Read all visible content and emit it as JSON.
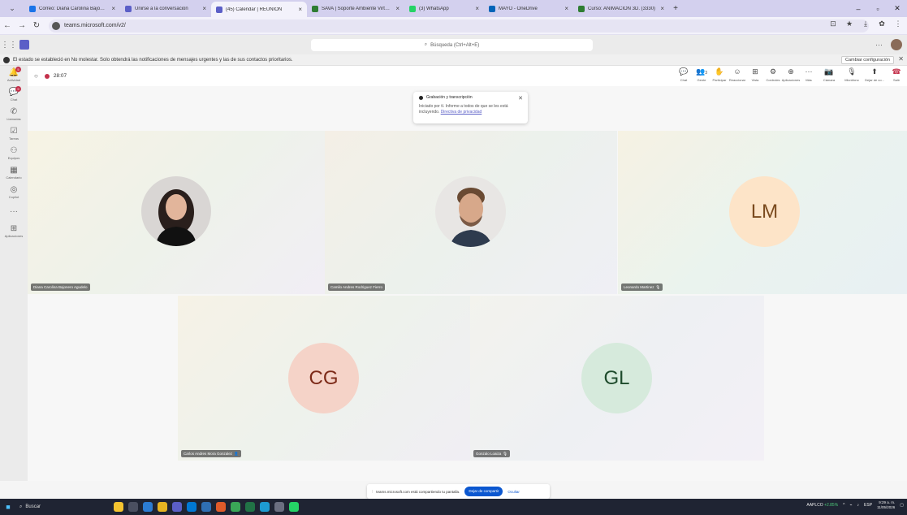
{
  "browser": {
    "tabs": [
      {
        "title": "Correo: Diana Carolina Bajonero",
        "color": "#1a73e8",
        "active": false
      },
      {
        "title": "Unirse a la conversación",
        "color": "#5b5fc7",
        "active": false
      },
      {
        "title": "(45) Calendar | REUNIÓN",
        "color": "#5b5fc7",
        "active": true
      },
      {
        "title": "SAVA | Soporte Ambiente Virtual",
        "color": "#2e7d32",
        "active": false
      },
      {
        "title": "(3) WhatsApp",
        "color": "#25d366",
        "active": false
      },
      {
        "title": "MAYO - OneDrive",
        "color": "#0364b8",
        "active": false
      },
      {
        "title": "Curso: ANIMACIÓN 3D. (3330)",
        "color": "#2e7d32",
        "active": false
      }
    ],
    "new_tab": "+",
    "url": "teams.microsoft.com/v2/"
  },
  "teams": {
    "search_placeholder": "Búsqueda (Ctrl+Alt+E)",
    "notice_text": "El estado se estableció en No molestar. Solo obtendrá las notificaciones de mensajes urgentes y las de sus contactos prioritarios.",
    "notice_button": "Cambiar configuración",
    "rail": [
      {
        "icon": "bell",
        "label": "Actividad",
        "badge": "5"
      },
      {
        "icon": "chat",
        "label": "Chat",
        "badge": "9"
      },
      {
        "icon": "phone",
        "label": "Llamadas",
        "badge": ""
      },
      {
        "icon": "tasks",
        "label": "Tareas",
        "badge": ""
      },
      {
        "icon": "teams",
        "label": "Equipos",
        "badge": ""
      },
      {
        "icon": "calendar",
        "label": "Calendario",
        "badge": ""
      },
      {
        "icon": "copilot",
        "label": "Copilot",
        "badge": ""
      },
      {
        "icon": "more",
        "label": "",
        "badge": ""
      },
      {
        "icon": "apps",
        "label": "Aplicaciones",
        "badge": ""
      }
    ]
  },
  "meeting": {
    "timer": "28:07",
    "controls": [
      {
        "icon": "chat",
        "label": "Chat"
      },
      {
        "icon": "people",
        "label": "Gente",
        "count": "3"
      },
      {
        "icon": "hand",
        "label": "Participar"
      },
      {
        "icon": "react",
        "label": "Reaccionar"
      },
      {
        "icon": "view",
        "label": "Vista"
      },
      {
        "icon": "controls",
        "label": "Controles"
      },
      {
        "icon": "apps",
        "label": "Aplicaciones"
      },
      {
        "icon": "more",
        "label": "Más"
      },
      {
        "icon": "camera",
        "label": "Cámara"
      },
      {
        "icon": "mic",
        "label": "Micrófono"
      },
      {
        "icon": "share",
        "label": "Dejar de co..."
      }
    ],
    "leave_label": "Salir",
    "recording_popup": {
      "title": "Grabación y transcripción",
      "body": "Iniciado por tí. Informe a todos de que se les está incluyendo.",
      "link": "Directiva de privacidad"
    },
    "participants": [
      {
        "name": "Diana Carolina Bajonero Agudelo",
        "initials": "",
        "type": "photo"
      },
      {
        "name": "Camilo Andres Rodriguez Fierro",
        "initials": "",
        "type": "photo"
      },
      {
        "name": "Leonardo Martinez",
        "initials": "LM",
        "type": "initials",
        "color": "#fde4c8",
        "text_color": "#7a4a1e"
      },
      {
        "name": "Carlos Andres Mora Gonzalez",
        "initials": "CG",
        "type": "initials",
        "color": "#f5d3c8",
        "text_color": "#7c2a18"
      },
      {
        "name": "Gonzalo Loaiza",
        "initials": "GL",
        "type": "initials",
        "color": "#d6eadc",
        "text_color": "#1e4b2c"
      }
    ]
  },
  "share_bar": {
    "text": "teams.microsoft.com está compartiendo tu pantalla.",
    "stop": "Dejar de compartir",
    "hide": "Ocultar"
  },
  "taskbar": {
    "search": "Buscar",
    "stock_name": "AAPLCO",
    "stock_change": "+2.85%",
    "lang": "ESP",
    "time": "9:29 a. m.",
    "date": "11/05/2026"
  }
}
